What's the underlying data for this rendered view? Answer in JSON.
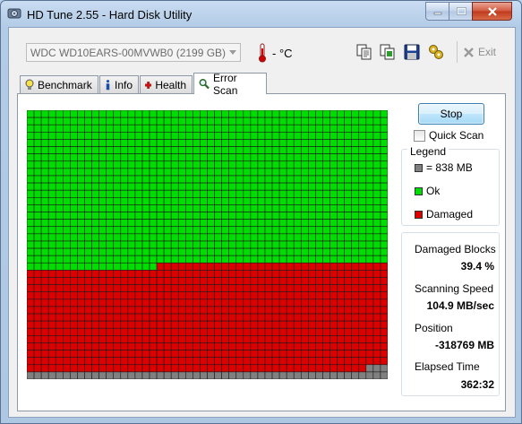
{
  "window": {
    "title": "HD Tune 2.55 - Hard Disk Utility"
  },
  "toolbar": {
    "drive": "WDC WD10EARS-00MVWB0 (2199 GB)",
    "temperature": "- °C",
    "exit_label": "Exit"
  },
  "tabs": [
    {
      "label": "Benchmark"
    },
    {
      "label": "Info"
    },
    {
      "label": "Health"
    },
    {
      "label": "Error Scan"
    }
  ],
  "scan": {
    "stop_label": "Stop",
    "quick_scan_label": "Quick Scan",
    "quick_scan_checked": false,
    "grid_columns": 50,
    "grid_rows": 37,
    "ok_blocks": 1068,
    "damaged_blocks": 729,
    "remaining_blocks": 53
  },
  "legend": {
    "title": "Legend",
    "items": [
      {
        "label": "= 838 MB",
        "color": "#808080"
      },
      {
        "label": "Ok",
        "color": "#00dd00"
      },
      {
        "label": "Damaged",
        "color": "#dd0000"
      }
    ]
  },
  "stats": {
    "damaged_label": "Damaged Blocks",
    "damaged_value": "39.4 %",
    "speed_label": "Scanning Speed",
    "speed_value": "104.9 MB/sec",
    "position_label": "Position",
    "position_value": "-318769 MB",
    "elapsed_label": "Elapsed Time",
    "elapsed_value": "362:32"
  },
  "colors": {
    "ok": "#00dd00",
    "damaged": "#dd0000",
    "unscanned": "#808080",
    "grid_line": "#1a1a1a"
  }
}
